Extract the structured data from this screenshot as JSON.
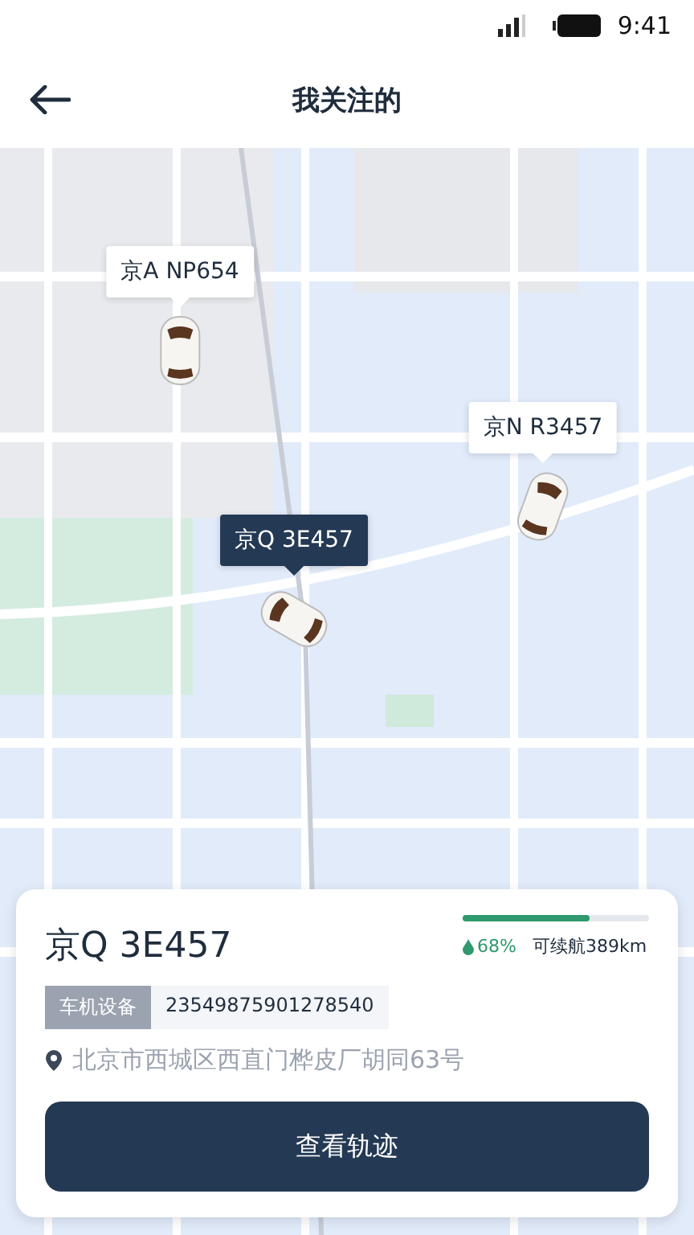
{
  "status_bar": {
    "time": "9:41"
  },
  "header": {
    "title": "我关注的"
  },
  "vehicles": [
    {
      "plate": "京A NP654",
      "selected": false
    },
    {
      "plate": "京N R3457",
      "selected": false
    },
    {
      "plate": "京Q 3E457",
      "selected": true
    }
  ],
  "card": {
    "plate": "京Q 3E457",
    "battery": {
      "level": 0.68,
      "percent": "68%",
      "range": "可续航389km"
    },
    "device_label": "车机设备",
    "device_id": "23549875901278540",
    "address": "北京市西城区西直门桦皮厂胡同63号",
    "button": "查看轨迹"
  }
}
